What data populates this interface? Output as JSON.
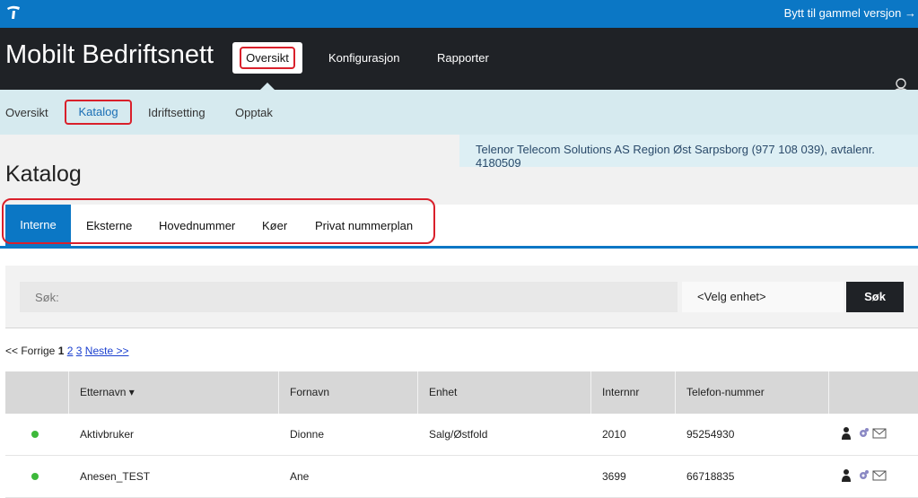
{
  "topbar": {
    "switch_label": "Bytt til gammel versjon →"
  },
  "header": {
    "app_title": "Mobilt Bedriftsnett",
    "nav": [
      "Oversikt",
      "Konfigurasjon",
      "Rapporter"
    ]
  },
  "subnav": [
    "Oversikt",
    "Katalog",
    "Idriftsetting",
    "Opptak"
  ],
  "org_info": "Telenor Telecom Solutions AS Region Øst Sarpsborg (977 108 039), avtalenr. 4180509",
  "page_title": "Katalog",
  "tabs": [
    "Interne",
    "Eksterne",
    "Hovednummer",
    "Køer",
    "Privat nummerplan"
  ],
  "search": {
    "placeholder": "Søk:",
    "unit_select": "<Velg enhet>",
    "button": "Søk"
  },
  "pager": {
    "prev": "<< Forrige",
    "current": "1",
    "pages": [
      "2",
      "3"
    ],
    "next": "Neste >>"
  },
  "table": {
    "headers": [
      "Etternavn ▾",
      "Fornavn",
      "Enhet",
      "Internnr",
      "Telefon-nummer"
    ],
    "rows": [
      {
        "lastname": "Aktivbruker",
        "firstname": "Dionne",
        "unit": "Salg/Østfold",
        "internal": "2010",
        "phone": "95254930"
      },
      {
        "lastname": "Anesen_TEST",
        "firstname": "Ane",
        "unit": "",
        "internal": "3699",
        "phone": "66718835"
      }
    ]
  },
  "colors": {
    "brand_blue": "#0b77c5",
    "dark": "#1f2226",
    "highlight_red": "#d9202b",
    "status_green": "#3db83a"
  }
}
